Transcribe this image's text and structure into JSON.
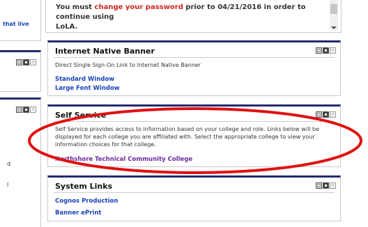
{
  "left_panels": [
    {
      "link_text": "that live"
    },
    {
      "fragment_1": "d",
      "fragment_2": "l"
    }
  ],
  "notice": {
    "line1_prefix": "You must ",
    "line1_highlight": "change your password",
    "line1_suffix": " prior to 04/21/2016 in order to continue using",
    "line2": "LoLA."
  },
  "portlets": {
    "internet_native_banner": {
      "title": "Internet Native Banner",
      "description": "Direct Single Sign-On Link to Internet Native Banner",
      "links": [
        "Standard Window",
        "Large Font Window"
      ]
    },
    "self_service": {
      "title": "Self Service",
      "description": "Self Service provides access to information based on your college and role.  Links below will be displayed for each college you are affiliated with.  Select the appropriate college to view your information choices for that college.",
      "links": [
        "Northshore Technical Community College"
      ]
    },
    "system_links": {
      "title": "System Links",
      "links": [
        "Cognos Production",
        "Banner ePrint"
      ]
    }
  },
  "controls": {
    "minimize": "□",
    "edit": "▪",
    "close": "×"
  },
  "colors": {
    "header_bar": "#232a6e",
    "link_blue": "#1a44b8",
    "link_visited": "#6b2c9a",
    "warning_red": "#d0271f",
    "annotation_red": "#e01010"
  },
  "icons": [
    "minimize-icon",
    "edit-icon",
    "close-icon",
    "scroll-down-arrow-icon"
  ]
}
